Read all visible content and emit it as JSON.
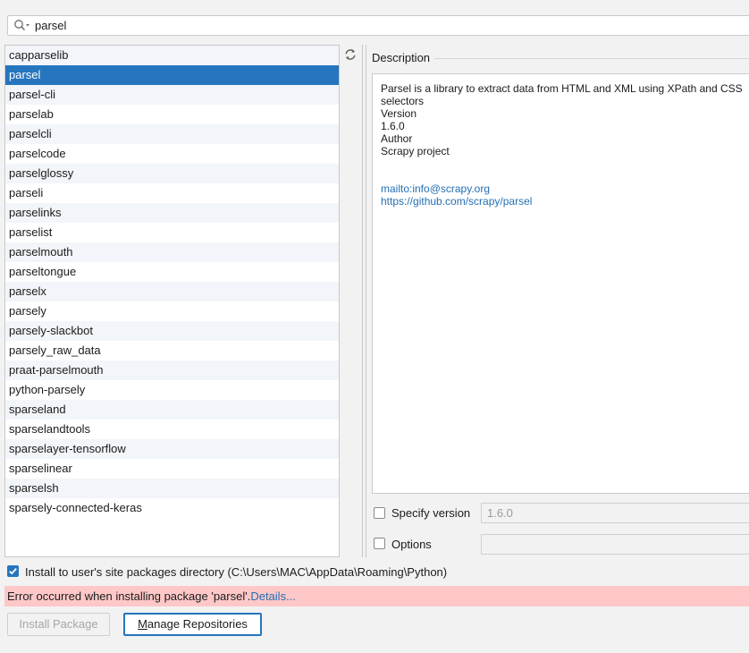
{
  "search": {
    "value": "parsel",
    "icon": "search-icon"
  },
  "packages": [
    "capparselib",
    "parsel",
    "parsel-cli",
    "parselab",
    "parselcli",
    "parselcode",
    "parselglossy",
    "parseli",
    "parselinks",
    "parselist",
    "parselmouth",
    "parseltongue",
    "parselx",
    "parsely",
    "parsely-slackbot",
    "parsely_raw_data",
    "praat-parselmouth",
    "python-parsely",
    "sparseland",
    "sparselandtools",
    "sparselayer-tensorflow",
    "sparselinear",
    "sparselsh",
    "sparsely-connected-keras"
  ],
  "selected_package": "parsel",
  "description": {
    "title": "Description",
    "summary_line1": "Parsel is a library to extract data from HTML and XML using XPath and CSS",
    "summary_line2": "selectors",
    "version_label": "Version",
    "version": "1.6.0",
    "author_label": "Author",
    "author": "Scrapy project",
    "mailto": "mailto:info@scrapy.org",
    "homepage": "https://github.com/scrapy/parsel"
  },
  "options": {
    "specify_version_label": "Specify version",
    "specify_version_value": "1.6.0",
    "options_label": "Options",
    "options_value": ""
  },
  "install_to_user": {
    "checked": true,
    "label": "Install to user's site packages directory (C:\\Users\\MAC\\AppData\\Roaming\\Python)"
  },
  "error": {
    "message": "Error occurred when installing package 'parsel'.",
    "details_link": "Details..."
  },
  "buttons": {
    "install": "Install Package",
    "manage_prefix": "M",
    "manage_rest": "anage Repositories"
  },
  "colors": {
    "selection": "#2675bf",
    "error_background": "#ffc8c8",
    "link": "#2470b3"
  }
}
